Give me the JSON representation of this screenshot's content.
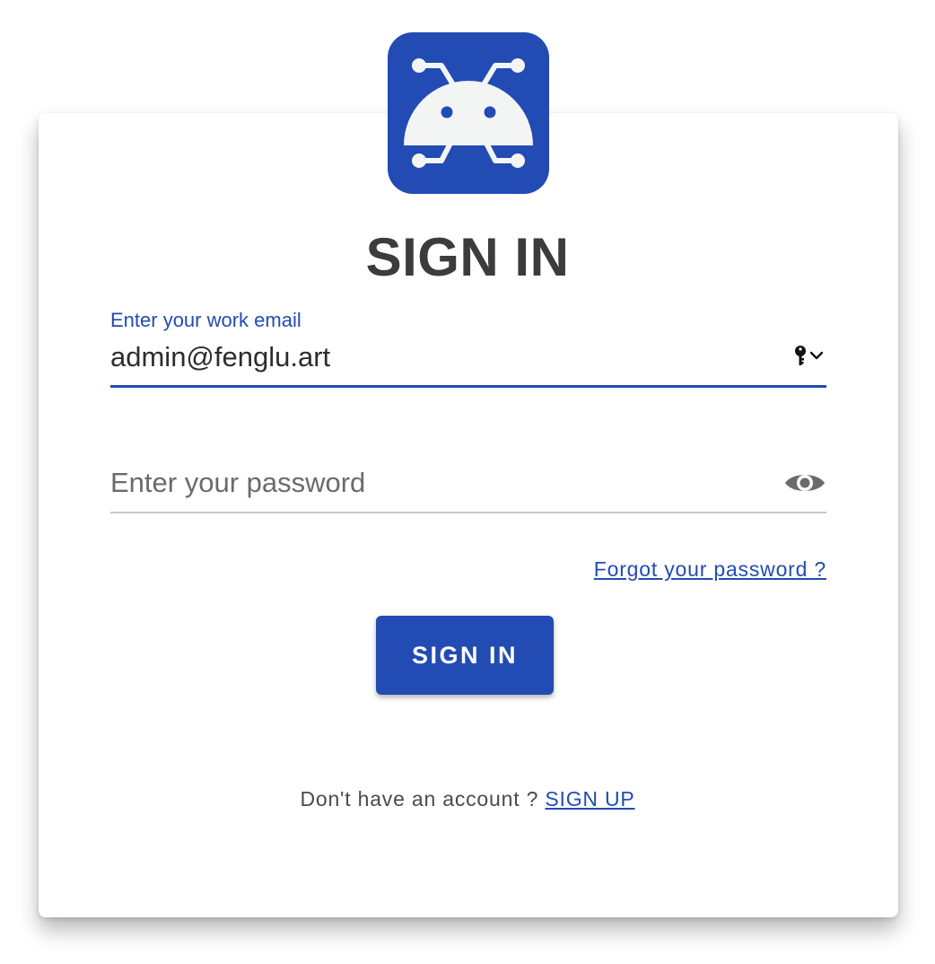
{
  "app": {
    "title": "SIGN IN"
  },
  "logo": {
    "icon": "robot-circuit-logo",
    "background_color": "#224bb4",
    "foreground_color": "#f3f5f5"
  },
  "email": {
    "label": "Enter your work email",
    "value": "admin@fenglu.art",
    "autofill_icon": "key-autofill-icon"
  },
  "password": {
    "placeholder": "Enter your password",
    "toggle_icon": "eye-icon"
  },
  "forgot_link": "Forgot your password ?",
  "submit": {
    "label": "SIGN IN"
  },
  "signup": {
    "prompt": "Don't have an account ?",
    "link": "SIGN UP"
  },
  "colors": {
    "accent": "#224bb4",
    "title": "#3c3c3c",
    "muted": "#6b6b6b"
  }
}
